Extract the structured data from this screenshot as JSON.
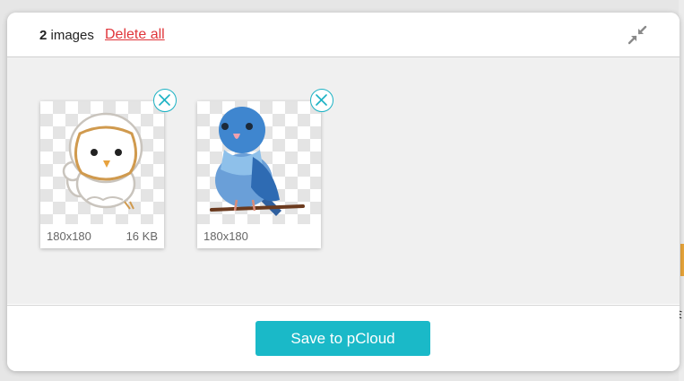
{
  "header": {
    "image_count": "2",
    "images_label": "images",
    "delete_all_label": "Delete all",
    "minimize_icon": "collapse-arrows-icon"
  },
  "images": [
    {
      "subject": "owl",
      "dimensions": "180x180",
      "file_size": "16 KB",
      "remove_icon": "close-circle-icon"
    },
    {
      "subject": "blue parakeet",
      "dimensions": "180x180",
      "file_size": "",
      "remove_icon": "close-circle-icon"
    }
  ],
  "footer": {
    "save_label": "Save to pCloud"
  },
  "colors": {
    "accent": "#1ab9c8",
    "danger": "#e0353a",
    "background": "#f0f0f0"
  }
}
